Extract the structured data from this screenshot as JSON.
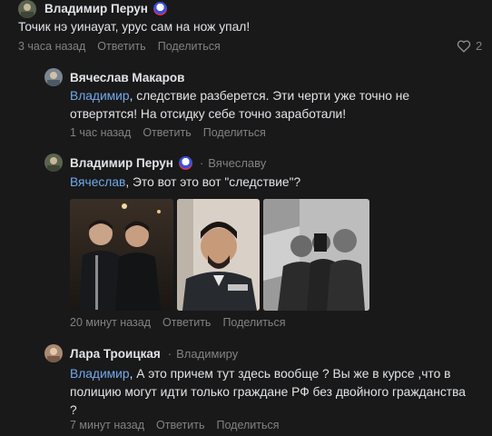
{
  "comments": [
    {
      "author": "Владимир Перун",
      "has_badge": true,
      "text": "Точик нэ уинауат, урус сам на нож упал!",
      "time": "3 часа назад",
      "reply_label": "Ответить",
      "share_label": "Поделиться",
      "likes": "2",
      "icons": {
        "like": "heart-icon",
        "badge": "community-badge-icon"
      }
    },
    {
      "author": "Вячеслав Макаров",
      "mention": "Владимир",
      "text": ", следствие разберется. Эти черти уже точно не отвертятся! На отсидку себе точно заработали!",
      "time": "1 час назад",
      "reply_label": "Ответить",
      "share_label": "Поделиться"
    },
    {
      "author": "Владимир Перун",
      "has_badge": true,
      "reply_to": "Вячеславу",
      "mention": "Вячеслав",
      "text": ", Это вот это вот \"следствие\"?",
      "time": "20 минут назад",
      "reply_label": "Ответить",
      "share_label": "Поделиться",
      "photos": [
        "photo-two-young-men",
        "photo-man-in-uniform",
        "photo-group-in-uniform"
      ]
    },
    {
      "author": "Лара Троицкая",
      "reply_to": "Владимиру",
      "mention": "Владимир",
      "text": ", А это причем тут здесь вообще ? Вы же в курсе ,что в полицию могут идти только граждане РФ без двойного гражданства ?",
      "time": "7 минут назад",
      "reply_label": "Ответить",
      "share_label": "Поделиться"
    }
  ],
  "colors": {
    "background": "#19191a",
    "text": "#e1e3e6",
    "secondary": "#828282",
    "mention": "#71aaeb"
  }
}
